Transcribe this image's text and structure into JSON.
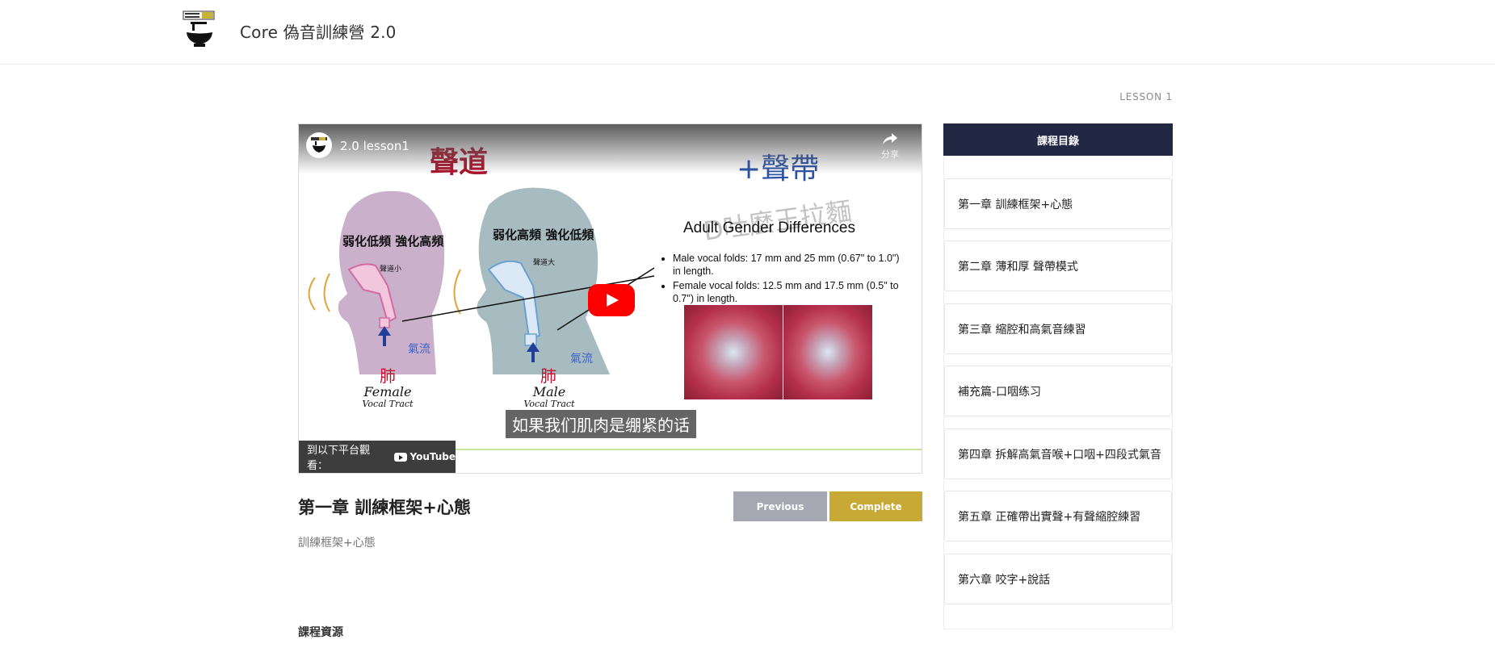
{
  "header": {
    "site_title": "Core 偽音訓練營 2.0",
    "logo_icon": "ramen-bowl-logo"
  },
  "lesson_tag": "LESSON 1",
  "video": {
    "title": "2.0 lesson1",
    "share_label": "分享",
    "slide": {
      "title_red": "聲道",
      "title_blue": "+聲帶",
      "watermark": "D吐麼王拉麵",
      "female_heading": "弱化低頻 強化高頻",
      "male_heading": "弱化高頻 強化低頻",
      "female_small": "聲道小",
      "male_small": "聲道大",
      "lung": "肺",
      "airflow": "氣流",
      "female_label": "Female",
      "male_label": "Male",
      "vocal_tract": "Vocal Tract",
      "adult_title": "Adult Gender Differences",
      "bullets": [
        "Male vocal folds: 17 mm and 25 mm (0.67\" to 1.0\") in length.",
        "Female vocal folds: 12.5 mm and 17.5 mm (0.5\" to 0.7\") in length."
      ]
    },
    "subtitle": "如果我们肌肉是绷紧的话",
    "watch_on_label": "到以下平台觀看：",
    "youtube_label": "YouTube",
    "accent_colors": {
      "play": "#ff0000",
      "progress": "#c7e69b"
    }
  },
  "lesson": {
    "title": "第一章 訓練框架+心態",
    "description": "訓練框架+心態",
    "previous_label": "Previous",
    "complete_label": "Complete",
    "resources_label": "課程資源"
  },
  "sidebar": {
    "heading": "課程目錄",
    "items": [
      {
        "label": "第一章 訓練框架+心態"
      },
      {
        "label": "第二章 薄和厚 聲帶模式"
      },
      {
        "label": "第三章 縮腔和高氣音練習"
      },
      {
        "label": "補充篇-口咽练习"
      },
      {
        "label": "第四章 拆解高氣音喉+口咽+四段式氣音"
      },
      {
        "label": "第五章 正確帶出實聲+有聲縮腔練習"
      },
      {
        "label": "第六章 咬字+說話"
      }
    ]
  },
  "colors": {
    "brand_dark": "#222844",
    "complete": "#c9a936",
    "previous": "#a5a8b3"
  }
}
